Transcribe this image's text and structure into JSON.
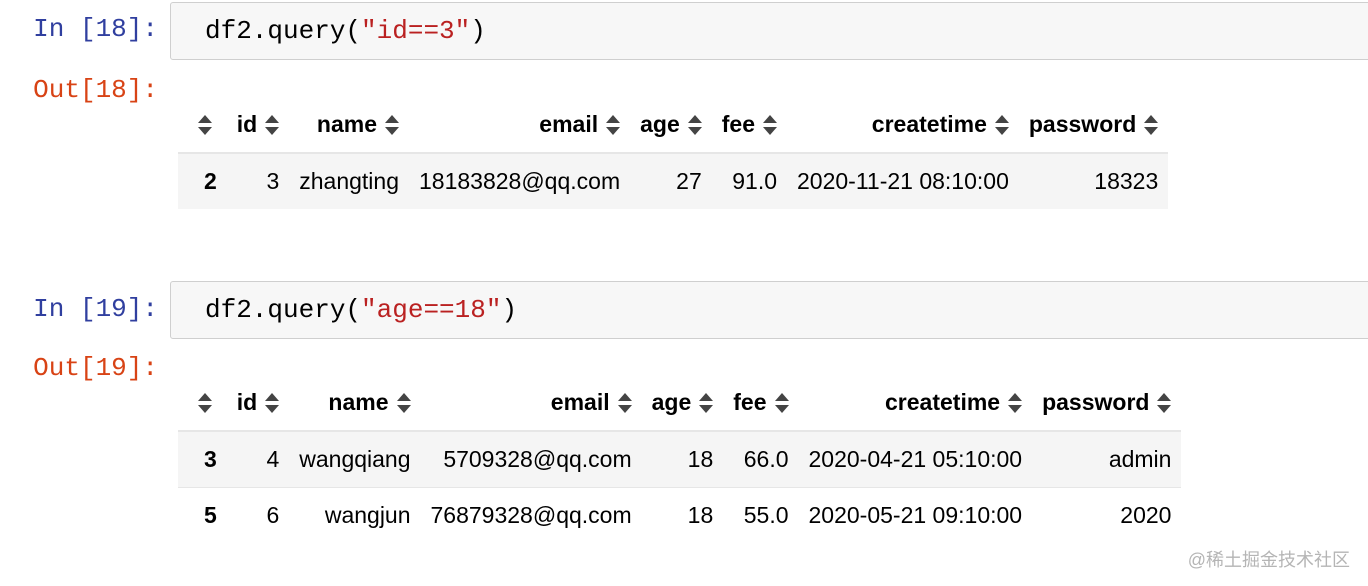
{
  "cells": [
    {
      "in_prompt": "In [18]:",
      "out_prompt": "Out[18]:",
      "code": {
        "call": "df2.query(",
        "arg": "\"id==3\"",
        "close": ")"
      },
      "columns": [
        "",
        "id",
        "name",
        "email",
        "age",
        "fee",
        "createtime",
        "password"
      ],
      "rows": [
        {
          "index": "2",
          "values": [
            "3",
            "zhangting",
            "18183828@qq.com",
            "27",
            "91.0",
            "2020-11-21 08:10:00",
            "18323"
          ]
        }
      ]
    },
    {
      "in_prompt": "In [19]:",
      "out_prompt": "Out[19]:",
      "code": {
        "call": "df2.query(",
        "arg": "\"age==18\"",
        "close": ")"
      },
      "columns": [
        "",
        "id",
        "name",
        "email",
        "age",
        "fee",
        "createtime",
        "password"
      ],
      "rows": [
        {
          "index": "3",
          "values": [
            "4",
            "wangqiang",
            "5709328@qq.com",
            "18",
            "66.0",
            "2020-04-21 05:10:00",
            "admin"
          ]
        },
        {
          "index": "5",
          "values": [
            "6",
            "wangjun",
            "76879328@qq.com",
            "18",
            "55.0",
            "2020-05-21 09:10:00",
            "2020"
          ]
        }
      ]
    }
  ],
  "watermark": "@稀土掘金技术社区",
  "icons": {
    "sort": "sort-icon"
  },
  "colors": {
    "in_prompt": "#303f9f",
    "out_prompt": "#d84315",
    "string_literal": "#ba2121"
  }
}
